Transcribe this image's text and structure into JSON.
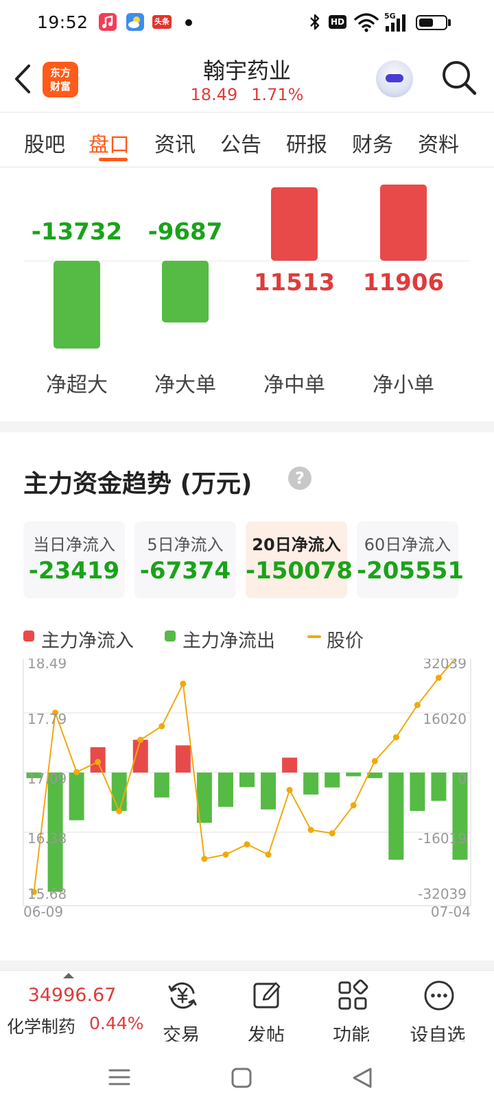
{
  "status_bar": {
    "time": "19:52",
    "news_badge": "头条",
    "hd_label": "HD",
    "signal_label": "5G"
  },
  "header": {
    "brand_logo_text": [
      "东方",
      "财富"
    ],
    "stock_name": "翰宇药业",
    "price": "18.49",
    "change_pct": "1.71%"
  },
  "tabs": [
    {
      "label": "股吧",
      "active": false
    },
    {
      "label": "盘口",
      "active": true
    },
    {
      "label": "资讯",
      "active": false
    },
    {
      "label": "公告",
      "active": false
    },
    {
      "label": "研报",
      "active": false
    },
    {
      "label": "财务",
      "active": false
    },
    {
      "label": "资料",
      "active": false
    }
  ],
  "flow_breakdown": {
    "items": [
      {
        "label": "净超大",
        "value": -13732
      },
      {
        "label": "净大单",
        "value": -9687
      },
      {
        "label": "净中单",
        "value": 11513
      },
      {
        "label": "净小单",
        "value": 11906
      }
    ],
    "colors": {
      "positive": "#e84a4a",
      "negative": "#55bb44"
    }
  },
  "trend_section": {
    "title": "主力资金趋势 (万元)",
    "help_glyph": "?",
    "cards": [
      {
        "label": "当日净流入",
        "value": "-23419",
        "active": false
      },
      {
        "label": "5日净流入",
        "value": "-67374",
        "active": false
      },
      {
        "label": "20日净流入",
        "value": "-150078",
        "active": true
      },
      {
        "label": "60日净流入",
        "value": "-205551",
        "active": false
      }
    ],
    "legend": {
      "inflow": "主力净流入",
      "outflow": "主力净流出",
      "price": "股价"
    }
  },
  "chart_data": {
    "type": "bar",
    "x_start_label": "06-09",
    "x_end_label": "07-04",
    "left_axis_ticks": [
      "18.49",
      "17.79",
      "17.09",
      "16.38",
      "15.68"
    ],
    "right_axis_ticks": [
      "32039",
      "16020",
      "0",
      "-16019",
      "-32039"
    ],
    "ylim_flow": [
      -32039,
      32039
    ],
    "ylim_price": [
      15.68,
      18.49
    ],
    "colors": {
      "inflow": "#e84a4a",
      "outflow": "#55bb44",
      "price": "#f1a90b"
    },
    "series": [
      {
        "name": "主力净流入/主力净流出",
        "values": [
          -1500,
          -32000,
          -12800,
          6800,
          -10300,
          8800,
          -6700,
          7300,
          -13500,
          -9200,
          -3900,
          -9900,
          4000,
          -5900,
          -4000,
          -1000,
          -1500,
          -23400,
          -10300,
          -7600,
          -23400
        ]
      },
      {
        "name": "股价",
        "values": [
          15.68,
          17.79,
          17.09,
          17.21,
          16.63,
          17.47,
          17.63,
          18.13,
          16.07,
          16.12,
          16.24,
          16.12,
          16.88,
          16.41,
          16.37,
          16.7,
          17.22,
          17.5,
          17.88,
          18.2,
          18.49
        ]
      }
    ]
  },
  "bottom_nav": {
    "index_value": "34996.67",
    "index_name": "化学制药",
    "index_pct": "0.44%",
    "items": [
      {
        "label": "交易",
        "icon": "yen-exchange-icon"
      },
      {
        "label": "发帖",
        "icon": "edit-post-icon"
      },
      {
        "label": "功能",
        "icon": "grid-apps-icon"
      },
      {
        "label": "设自选",
        "icon": "more-dots-icon"
      }
    ]
  }
}
